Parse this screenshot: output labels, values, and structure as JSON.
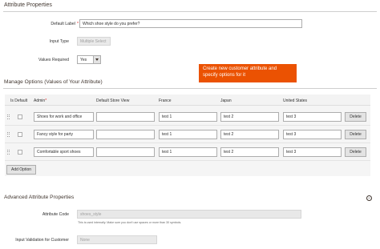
{
  "attribute_properties": {
    "section_title": "Attribute Properties",
    "default_label": {
      "label": "Default Label",
      "required_mark": "*",
      "value": "Which shoe style do you prefer?"
    },
    "input_type": {
      "label": "Input Type",
      "value": "Multiple Select"
    },
    "values_required": {
      "label": "Values Required",
      "value": "Yes"
    }
  },
  "tooltip": {
    "text": "Create new customer attribute and specify options for it"
  },
  "manage_options": {
    "section_title": "Manage Options (Values of Your Attribute)",
    "columns": {
      "is_default": "Is Default",
      "admin": "Admin",
      "admin_required_mark": "*",
      "default_store_view": "Default Store View",
      "france": "France",
      "japan": "Japan",
      "united_states": "United States"
    },
    "rows": [
      {
        "admin": "Shoes for work and office",
        "default_store_view": "",
        "france": "test 1",
        "japan": "test 2",
        "united_states": "test 3",
        "delete": "Delete"
      },
      {
        "admin": "Fancy style for party",
        "default_store_view": "",
        "france": "test 1",
        "japan": "test 2",
        "united_states": "test 3",
        "delete": "Delete"
      },
      {
        "admin": "Comfortable sport shoes",
        "default_store_view": "",
        "france": "test 1",
        "japan": "test 2",
        "united_states": "test 3",
        "delete": "Delete"
      }
    ],
    "add_option": "Add Option"
  },
  "advanced": {
    "section_title": "Advanced Attribute Properties",
    "attribute_code": {
      "label": "Attribute Code",
      "value": "shoes_style",
      "hint": "This is used internally. Make sure you don't use spaces or more than 30 symbols."
    },
    "input_validation": {
      "label": "Input Validation for Customer",
      "value": "None"
    }
  },
  "colors": {
    "accent": "#eb5202",
    "required": "#e22626"
  }
}
